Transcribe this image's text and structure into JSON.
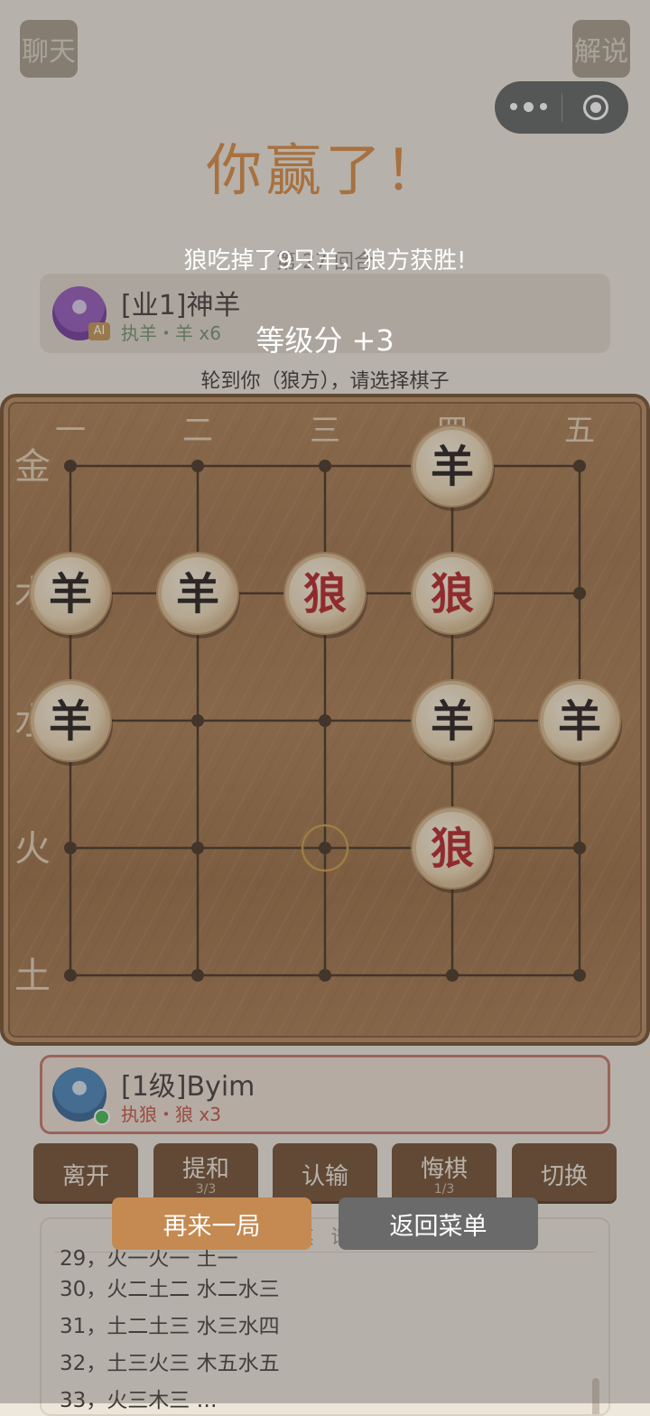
{
  "header": {
    "chat_label": "聊天",
    "explain_label": "解说"
  },
  "round_info": "第 27 回合",
  "opponent": {
    "name": "[业1]神羊",
    "info": "执羊・羊 x6",
    "ai_badge": "AI"
  },
  "player": {
    "name": "[1级]Byim",
    "info": "执狼・狼 x3"
  },
  "turn_text": "轮到你（狼方），请选择棋子",
  "board": {
    "columns": [
      "一",
      "二",
      "三",
      "四",
      "五"
    ],
    "rows": [
      "金",
      "木",
      "水",
      "火",
      "土"
    ],
    "pieces": [
      {
        "text": "羊",
        "side": "sheep",
        "col": 3,
        "row": 0
      },
      {
        "text": "羊",
        "side": "sheep",
        "col": 0,
        "row": 1
      },
      {
        "text": "羊",
        "side": "sheep",
        "col": 1,
        "row": 1
      },
      {
        "text": "狼",
        "side": "wolf",
        "col": 2,
        "row": 1
      },
      {
        "text": "狼",
        "side": "wolf",
        "col": 3,
        "row": 1
      },
      {
        "text": "羊",
        "side": "sheep",
        "col": 0,
        "row": 2
      },
      {
        "text": "羊",
        "side": "sheep",
        "col": 3,
        "row": 2
      },
      {
        "text": "羊",
        "side": "sheep",
        "col": 4,
        "row": 2
      },
      {
        "text": "狼",
        "side": "wolf",
        "col": 3,
        "row": 3
      }
    ],
    "last_move_marker": {
      "col": 2,
      "row": 3
    }
  },
  "actions": [
    {
      "label": "离开"
    },
    {
      "label": "提和",
      "sub": "3/3"
    },
    {
      "label": "认输"
    },
    {
      "label": "悔棋",
      "sub": "1/3"
    },
    {
      "label": "切换"
    }
  ],
  "record": {
    "title": "棋 谱",
    "rows": [
      "29，火一火一 土一",
      "30，火二土二 水二水三",
      "31，土二土三 水三水四",
      "32，土三火三 木五水五",
      "33，火三木三 …"
    ]
  },
  "modal": {
    "title": "你赢了！",
    "message": "狼吃掉了9只羊，狼方获胜!",
    "rating": "等级分 +3",
    "replay_label": "再来一局",
    "menu_label": "返回菜单"
  },
  "colors": {
    "wolf": "#b3171b",
    "sheep": "#1a1210",
    "accent": "#a8713f"
  }
}
